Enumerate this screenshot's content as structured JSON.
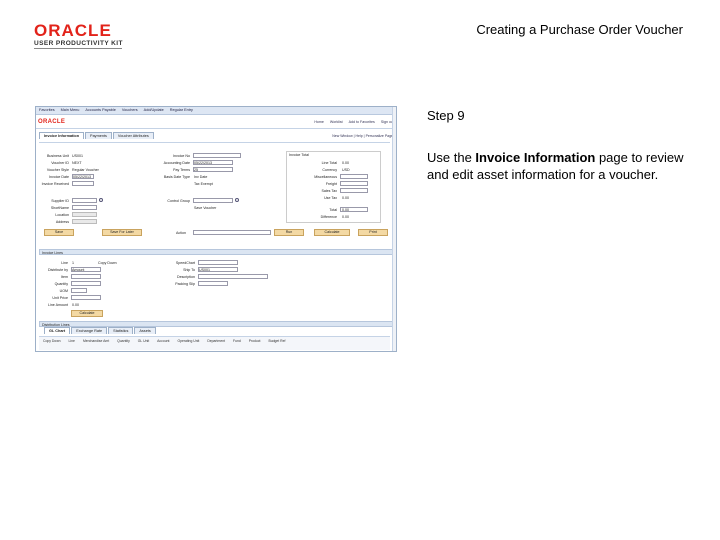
{
  "slide": {
    "title": "Creating a Purchase Order Voucher",
    "logo_brand": "ORACLE",
    "logo_sub": "USER PRODUCTIVITY KIT",
    "step": "Step 9",
    "instruction_before": "Use the ",
    "instruction_bold": "Invoice Information",
    "instruction_after": "  page to review and edit asset information for a voucher."
  },
  "app": {
    "nav": [
      "Favorites",
      "Main Menu",
      "Accounts Payable",
      "Vouchers",
      "Add/Update",
      "Regular Entry"
    ],
    "brand": "ORACLE",
    "header_links": [
      "Home",
      "Worklist",
      "Add to Favorites",
      "Sign out"
    ],
    "tabs": [
      "Invoice Information",
      "Payments",
      "Voucher Attributes"
    ],
    "tab_right": "New Window | Help | Personalize Page",
    "left_fields": [
      "Business Unit",
      "Voucher ID",
      "Voucher Style",
      "Invoice Date",
      "Invoice Received",
      "Supplier ID",
      "ShortName",
      "Location",
      "Address"
    ],
    "left_values": [
      "US001",
      "NEXT",
      "Regular Voucher",
      "05/22/2013",
      "",
      "",
      "",
      "",
      ""
    ],
    "mid_fields": [
      "Invoice No",
      "Accounting Date",
      "Pay Terms",
      "Basis Date Type",
      "Control Group"
    ],
    "mid_values": [
      "",
      "05/22/2013",
      "25",
      "Inv Date",
      ""
    ],
    "mid_checks": [
      "Tax Exempt",
      "Save Voucher"
    ],
    "right_title": "Invoice Total",
    "right_fields": [
      "Line Total",
      "Currency",
      "Miscellaneous",
      "Freight",
      "Sales Tax",
      "Use Tax",
      "Total",
      "Difference"
    ],
    "right_values": [
      "0.00",
      "USD",
      "",
      "",
      "",
      "0.00",
      "0.00",
      "0.00"
    ],
    "buttons_row1": [
      "Save",
      "Save For Later",
      "Action",
      "Run",
      "Calculate",
      "Print"
    ],
    "lines_bar": "Invoice Lines",
    "line_fields": [
      "Line",
      "Distribute by",
      "Item",
      "Quantity",
      "UOM",
      "Unit Price",
      "Line Amount"
    ],
    "line_values": [
      "1",
      "Amount",
      "",
      "",
      "",
      "",
      "0.00"
    ],
    "line_mid_fields": [
      "SpeedChart",
      "Ship To",
      "Description",
      "Packing Slip"
    ],
    "line_mid_values": [
      "",
      "US001",
      "",
      ""
    ],
    "copy_down": "Copy Down",
    "calc_btn": "Calculate",
    "dist_bar": "Distribution Lines",
    "dist_tabs": [
      "GL Chart",
      "Exchange Rate",
      "Statistics",
      "Assets"
    ],
    "dist_cols": [
      "Copy Down",
      "Line",
      "Merchandise Amt",
      "Quantity",
      "GL Unit",
      "Account",
      "Operating Unit",
      "Department",
      "Fund",
      "Product",
      "Budget Ref"
    ]
  }
}
